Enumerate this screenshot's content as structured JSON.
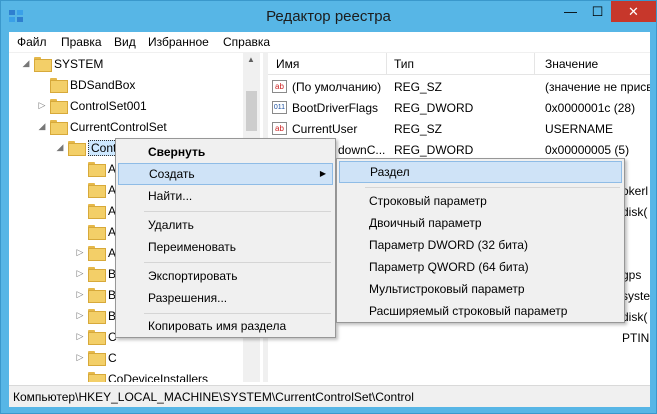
{
  "window": {
    "title": "Редактор реестра",
    "minimize": "—",
    "maximize": "☐",
    "close": "✕"
  },
  "menu": [
    "Файл",
    "Правка",
    "Вид",
    "Избранное",
    "Справка"
  ],
  "tree": {
    "root": "SYSTEM",
    "items": [
      "BDSandBox",
      "ControlSet001",
      "CurrentControlSet",
      "Control",
      "CoDeviceInstallers"
    ],
    "partial": [
      "A",
      "A",
      "A",
      "A",
      "A",
      "B",
      "B",
      "B",
      "C",
      "C",
      "C"
    ]
  },
  "list": {
    "columns": [
      "Имя",
      "Тип",
      "Значение"
    ],
    "rows": [
      {
        "name": "(По умолчанию)",
        "type": "REG_SZ",
        "value": "(значение не присв",
        "icon": "ab"
      },
      {
        "name": "BootDriverFlags",
        "type": "REG_DWORD",
        "value": "0x0000001c (28)",
        "icon": "bin"
      },
      {
        "name": "CurrentUser",
        "type": "REG_SZ",
        "value": "USERNAME",
        "icon": "ab"
      },
      {
        "name": "downC...",
        "type": "REG_DWORD",
        "value": "0x00000005 (5)",
        "icon": "bin"
      }
    ],
    "overflow": [
      "okerl",
      "disk(",
      "gps",
      "syste",
      "disk(",
      "PTIN"
    ]
  },
  "context_menu": {
    "items": [
      "Свернуть",
      "Создать",
      "Найти...",
      "Удалить",
      "Переименовать",
      "Экспортировать",
      "Разрешения...",
      "Копировать имя раздела"
    ]
  },
  "submenu": {
    "items": [
      "Раздел",
      "Строковый параметр",
      "Двоичный параметр",
      "Параметр DWORD (32 бита)",
      "Параметр QWORD (64 бита)",
      "Мультистроковый параметр",
      "Расширяемый строковый параметр"
    ]
  },
  "status": "Компьютер\\HKEY_LOCAL_MACHINE\\SYSTEM\\CurrentControlSet\\Control",
  "colors": {
    "titlebar": "#57b6e6",
    "close": "#c7372b",
    "highlight": "#cfe3f7",
    "folder": "#f3cf68"
  }
}
